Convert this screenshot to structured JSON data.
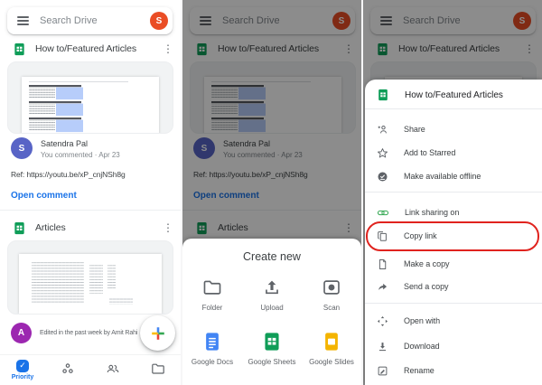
{
  "app": {
    "search_placeholder": "Search Drive",
    "account_initial": "S"
  },
  "files": {
    "card1_title": "How to/Featured Articles",
    "card2_title": "Articles"
  },
  "comment": {
    "initial": "S",
    "name": "Satendra Pal",
    "meta": "You commented · Apr 23",
    "ref": "Ref: https://youtu.be/xP_cnjNSh8g",
    "action": "Open comment"
  },
  "activity": {
    "initial": "A",
    "text": "Edited in the past week by Amit Rahi"
  },
  "nav": {
    "priority_label": "Priority"
  },
  "create_sheet": {
    "title": "Create new",
    "items": [
      {
        "label": "Folder"
      },
      {
        "label": "Upload"
      },
      {
        "label": "Scan"
      },
      {
        "label": "Google Docs"
      },
      {
        "label": "Google Sheets"
      },
      {
        "label": "Google Slides"
      }
    ]
  },
  "context_menu": {
    "title": "How to/Featured Articles",
    "items": [
      {
        "label": "Share"
      },
      {
        "label": "Add to Starred"
      },
      {
        "label": "Make available offline"
      },
      {
        "label": "Link sharing on"
      },
      {
        "label": "Copy link"
      },
      {
        "label": "Make a copy"
      },
      {
        "label": "Send a copy"
      },
      {
        "label": "Open with"
      },
      {
        "label": "Download"
      },
      {
        "label": "Rename"
      }
    ]
  },
  "colors": {
    "accent_blue": "#1a73e8",
    "sheets_green": "#0f9d58",
    "docs_blue": "#4285f4",
    "slides_yellow": "#f4b400",
    "link_green": "#34a853",
    "annotation_red": "#e0231e",
    "avatar_orange": "#ea4d25",
    "avatar_indigo": "#5864c6",
    "avatar_purple": "#9c27b0"
  }
}
